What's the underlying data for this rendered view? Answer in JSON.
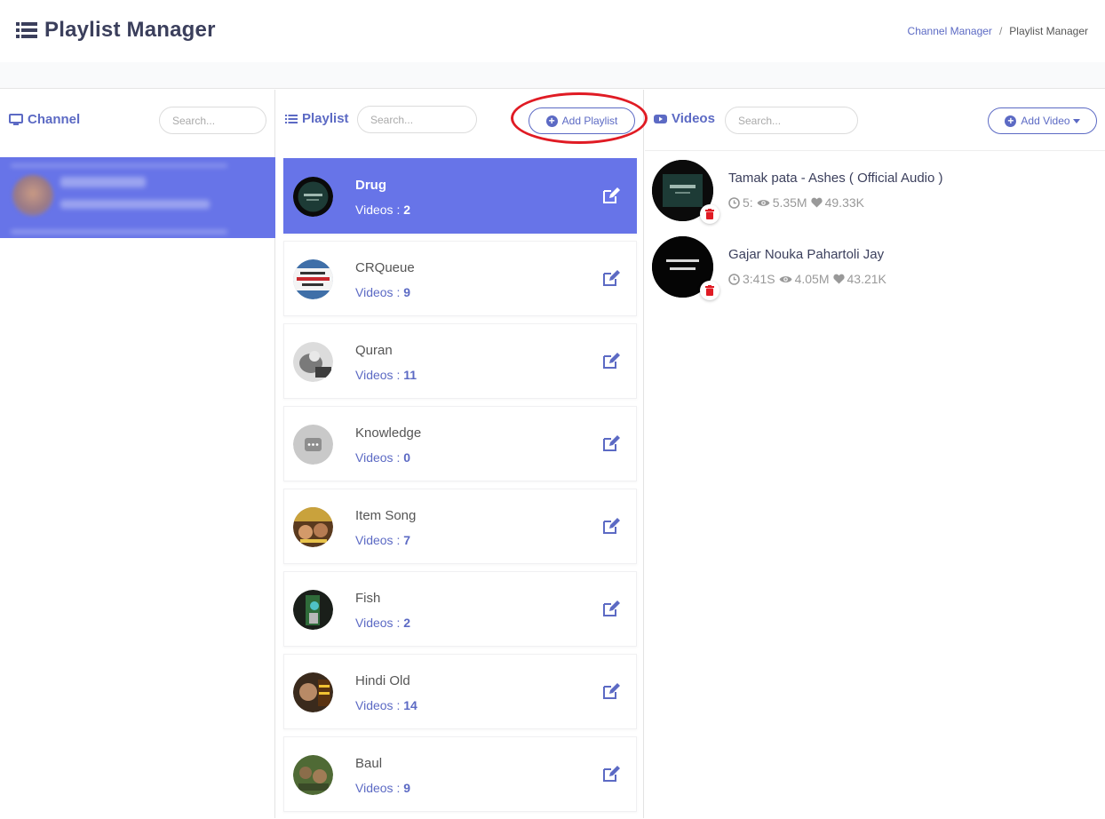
{
  "header": {
    "title": "Playlist Manager",
    "breadcrumb": {
      "link": "Channel Manager",
      "separator": "/",
      "current": "Playlist Manager"
    }
  },
  "channel": {
    "label": "Channel",
    "search_placeholder": "Search..."
  },
  "playlist": {
    "label": "Playlist",
    "search_placeholder": "Search...",
    "add_button": "Add Playlist",
    "count_prefix": "Videos : ",
    "items": [
      {
        "name": "Drug",
        "count": "2",
        "active": true
      },
      {
        "name": "CRQueue",
        "count": "9",
        "active": false
      },
      {
        "name": "Quran",
        "count": "11",
        "active": false
      },
      {
        "name": "Knowledge",
        "count": "0",
        "active": false
      },
      {
        "name": "Item Song",
        "count": "7",
        "active": false
      },
      {
        "name": "Fish",
        "count": "2",
        "active": false
      },
      {
        "name": "Hindi Old",
        "count": "14",
        "active": false
      },
      {
        "name": "Baul",
        "count": "9",
        "active": false
      }
    ]
  },
  "videos": {
    "label": "Videos",
    "search_placeholder": "Search...",
    "add_button": "Add Video",
    "items": [
      {
        "title": "Tamak pata - Ashes ( Official Audio )",
        "duration": "5:",
        "views": "5.35M",
        "likes": "49.33K"
      },
      {
        "title": "Gajar Nouka Pahartoli Jay",
        "duration": "3:41S",
        "views": "4.05M",
        "likes": "43.21K"
      }
    ]
  },
  "colors": {
    "accent": "#5c6ac4",
    "active_bg": "#6774e8",
    "delete": "#e01b24",
    "highlight_ring": "#e01b24"
  }
}
